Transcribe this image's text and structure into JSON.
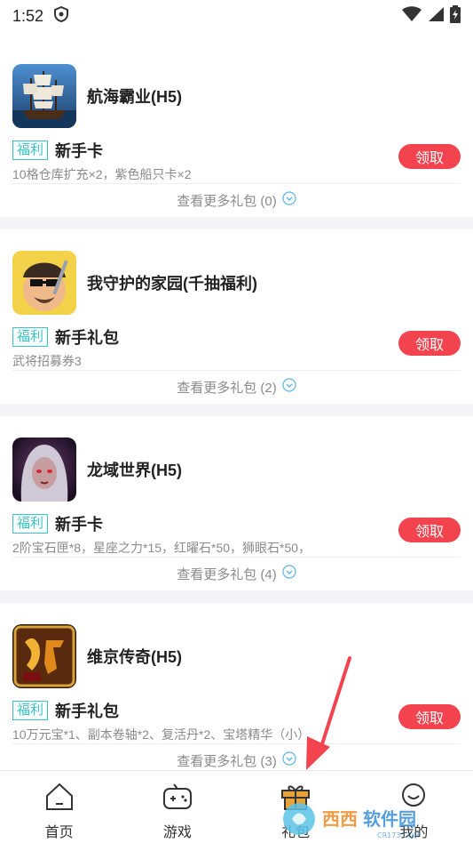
{
  "status_bar": {
    "time": "1:52"
  },
  "cards": [
    {
      "title": "航海霸业(H5)",
      "tag": "福利",
      "gift_name": "新手卡",
      "gift_desc": "10格仓库扩充×2，紫色船只卡×2",
      "claim_label": "领取",
      "more_label": "查看更多礼包 (0)"
    },
    {
      "title": "我守护的家园(千抽福利)",
      "tag": "福利",
      "gift_name": "新手礼包",
      "gift_desc": "武将招募券3",
      "claim_label": "领取",
      "more_label": "查看更多礼包 (2)"
    },
    {
      "title": "龙域世界(H5)",
      "tag": "福利",
      "gift_name": "新手卡",
      "gift_desc": "2阶宝石匣*8，星座之力*15，红曜石*50，狮眼石*50，",
      "claim_label": "领取",
      "more_label": "查看更多礼包 (4)"
    },
    {
      "title": "维京传奇(H5)",
      "tag": "福利",
      "gift_name": "新手礼包",
      "gift_desc": "10万元宝*1、副本卷轴*2、复活丹*2、宝塔精华（小）",
      "claim_label": "领取",
      "more_label": "查看更多礼包 (3)"
    }
  ],
  "tabbar": {
    "tabs": [
      {
        "label": "首页",
        "icon": "home-icon"
      },
      {
        "label": "游戏",
        "icon": "gamepad-icon"
      },
      {
        "label": "礼包",
        "icon": "gift-icon"
      },
      {
        "label": "我的",
        "icon": "profile-icon"
      }
    ]
  },
  "watermark": {
    "text": "西西软件园",
    "subtext": "CR173.COM"
  },
  "colors": {
    "accent": "#f2434f",
    "tag": "#37c5c9",
    "overlay_arrow": "#f2434f"
  }
}
